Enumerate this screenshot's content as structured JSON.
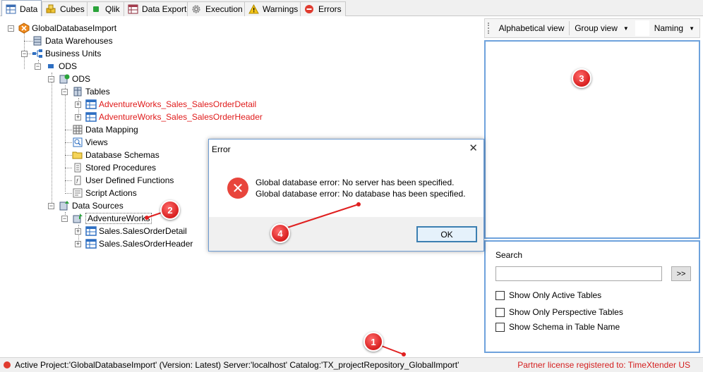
{
  "tabs": [
    {
      "label": "Data",
      "icon": "table-icon"
    },
    {
      "label": "Cubes",
      "icon": "cubes-icon"
    },
    {
      "label": "Qlik",
      "icon": "qlik-icon"
    },
    {
      "label": "Data Export",
      "icon": "data-export-icon"
    },
    {
      "label": "Execution",
      "icon": "gear-icon"
    },
    {
      "label": "Warnings",
      "icon": "warning-icon"
    },
    {
      "label": "Errors",
      "icon": "error-icon"
    }
  ],
  "tree": {
    "root": "GlobalDatabaseImport",
    "data_warehouses": "Data Warehouses",
    "business_units": "Business Units",
    "ods_unit": "ODS",
    "ods": "ODS",
    "tables": "Tables",
    "table_items": [
      "AdventureWorks_Sales_SalesOrderDetail",
      "AdventureWorks_Sales_SalesOrderHeader"
    ],
    "data_mapping": "Data Mapping",
    "views": "Views",
    "database_schemas": "Database Schemas",
    "stored_procedures": "Stored Procedures",
    "user_defined_functions": "User Defined Functions",
    "script_actions": "Script Actions",
    "data_sources": "Data Sources",
    "adventureworks": "AdventureWorks",
    "source_tables": [
      "Sales.SalesOrderDetail",
      "Sales.SalesOrderHeader"
    ]
  },
  "right_toolbar": {
    "alphabetical": "Alphabetical view",
    "group": "Group view",
    "naming": "Naming"
  },
  "search": {
    "label": "Search",
    "value": "",
    "go_label": ">>",
    "options": [
      "Show Only Active Tables",
      "Show Only Perspective Tables",
      "Show Schema in Table Name"
    ]
  },
  "dialog": {
    "title": "Error",
    "close": "✕",
    "message_1": "Global database error: No server has been specified.",
    "message_2": "Global database error: No database has been specified.",
    "ok": "OK"
  },
  "status": {
    "left": "Active Project:'GlobalDatabaseImport' (Version: Latest) Server:'localhost' Catalog:'TX_projectRepository_GlobalImport'",
    "right": "Partner license registered to: TimeXtender US"
  },
  "callouts": [
    "1",
    "2",
    "3",
    "4"
  ],
  "colors": {
    "accent_blue": "#6ea2dc",
    "error_red": "#e01b1b",
    "callout_red": "#d81f1f"
  }
}
